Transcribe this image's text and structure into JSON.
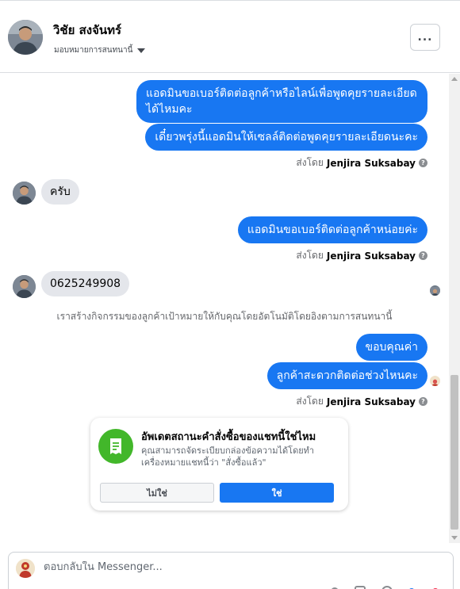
{
  "header": {
    "contact_name": "วิชัย สงจันทร์",
    "assign_label": "มอบหมายการสนทนานี้",
    "more_label": "..."
  },
  "messages": {
    "m1": "แอดมินขอเบอร์ติดต่อลูกค้าหรือไลน์เพื่อพูดคุยรายละเอียด",
    "m1b": "ได้ไหมคะ",
    "m2": "เดี๋ยวพรุ่งนี้แอดมินให้เซลล์ติดต่อพูดคุยรายละเอียดนะคะ",
    "m3": "ครับ",
    "m4": "แอดมินขอเบอร์ติดต่อลูกค้าหน่อยค่ะ",
    "m5": "0625249908",
    "m6": "ขอบคุณค่า",
    "m7": "ลูกค้าสะดวกติดต่อช่วงไหนคะ"
  },
  "sent_by": {
    "prefix": "ส่งโดย",
    "name": "Jenjira Suksabay"
  },
  "system_note": "เราสร้างกิจกรรมของลูกค้าเป้าหมายให้กับคุณโดยอัตโนมัติโดยอิงตามการสนทนานี้",
  "card": {
    "title": "อัพเดตสถานะคำสั่งซื้อของแชทนี้ใช่ไหม",
    "description": "คุณสามารถจัดระเบียบกล่องข้อความได้โดยทำเครื่องหมายแชทนี้ว่า \"สั่งซื้อแล้ว\"",
    "no_label": "ไม่ใช่",
    "yes_label": "ใช่",
    "icon": "order-receipt-icon"
  },
  "composer": {
    "placeholder": "ตอบกลับใน Messenger..."
  },
  "colors": {
    "accent": "#1877f2",
    "incoming_bubble": "#e4e6eb",
    "card_icon_bg": "#42b72a"
  }
}
